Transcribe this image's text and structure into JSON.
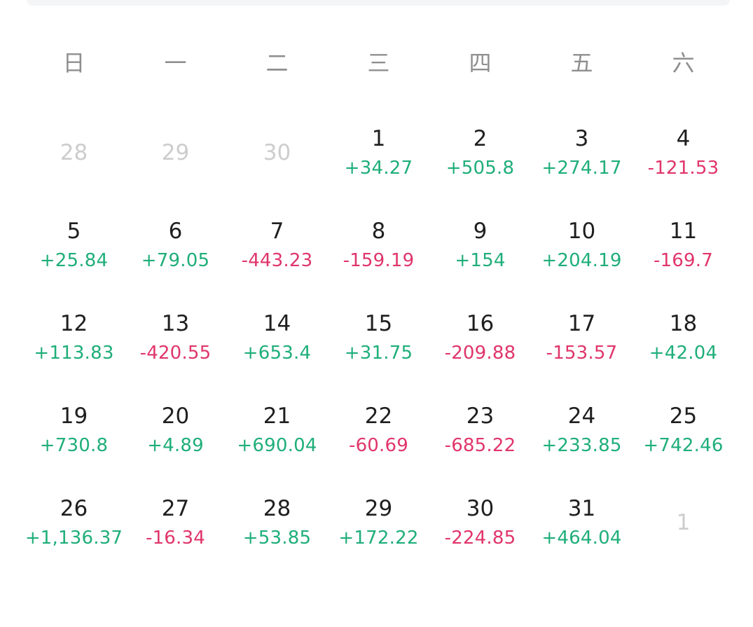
{
  "weekdays": [
    "日",
    "一",
    "二",
    "三",
    "四",
    "五",
    "六"
  ],
  "colors": {
    "positive": "#1fae7a",
    "negative": "#e0356b",
    "muted": "#cdcdcd"
  },
  "cells": [
    {
      "day": "28",
      "amount": "",
      "in_month": false
    },
    {
      "day": "29",
      "amount": "",
      "in_month": false
    },
    {
      "day": "30",
      "amount": "",
      "in_month": false
    },
    {
      "day": "1",
      "amount": "+34.27",
      "in_month": true
    },
    {
      "day": "2",
      "amount": "+505.8",
      "in_month": true
    },
    {
      "day": "3",
      "amount": "+274.17",
      "in_month": true
    },
    {
      "day": "4",
      "amount": "-121.53",
      "in_month": true
    },
    {
      "day": "5",
      "amount": "+25.84",
      "in_month": true
    },
    {
      "day": "6",
      "amount": "+79.05",
      "in_month": true
    },
    {
      "day": "7",
      "amount": "-443.23",
      "in_month": true
    },
    {
      "day": "8",
      "amount": "-159.19",
      "in_month": true
    },
    {
      "day": "9",
      "amount": "+154",
      "in_month": true
    },
    {
      "day": "10",
      "amount": "+204.19",
      "in_month": true
    },
    {
      "day": "11",
      "amount": "-169.7",
      "in_month": true
    },
    {
      "day": "12",
      "amount": "+113.83",
      "in_month": true
    },
    {
      "day": "13",
      "amount": "-420.55",
      "in_month": true
    },
    {
      "day": "14",
      "amount": "+653.4",
      "in_month": true
    },
    {
      "day": "15",
      "amount": "+31.75",
      "in_month": true
    },
    {
      "day": "16",
      "amount": "-209.88",
      "in_month": true
    },
    {
      "day": "17",
      "amount": "-153.57",
      "in_month": true
    },
    {
      "day": "18",
      "amount": "+42.04",
      "in_month": true
    },
    {
      "day": "19",
      "amount": "+730.8",
      "in_month": true
    },
    {
      "day": "20",
      "amount": "+4.89",
      "in_month": true
    },
    {
      "day": "21",
      "amount": "+690.04",
      "in_month": true
    },
    {
      "day": "22",
      "amount": "-60.69",
      "in_month": true
    },
    {
      "day": "23",
      "amount": "-685.22",
      "in_month": true
    },
    {
      "day": "24",
      "amount": "+233.85",
      "in_month": true
    },
    {
      "day": "25",
      "amount": "+742.46",
      "in_month": true
    },
    {
      "day": "26",
      "amount": "+1,136.37",
      "in_month": true
    },
    {
      "day": "27",
      "amount": "-16.34",
      "in_month": true
    },
    {
      "day": "28",
      "amount": "+53.85",
      "in_month": true
    },
    {
      "day": "29",
      "amount": "+172.22",
      "in_month": true
    },
    {
      "day": "30",
      "amount": "-224.85",
      "in_month": true
    },
    {
      "day": "31",
      "amount": "+464.04",
      "in_month": true
    },
    {
      "day": "1",
      "amount": "",
      "in_month": false
    }
  ]
}
